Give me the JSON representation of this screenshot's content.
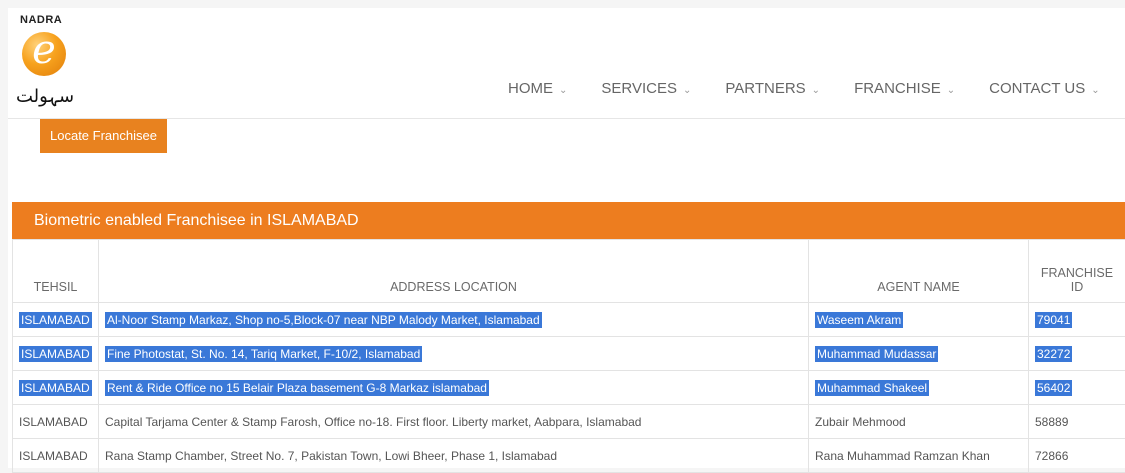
{
  "brand": {
    "top_label": "NADRA",
    "logo_letter": "e",
    "urdu_text": "سہولت"
  },
  "nav": {
    "items": [
      {
        "label": "HOME",
        "chev": "⌄"
      },
      {
        "label": "SERVICES",
        "chev": "⌄"
      },
      {
        "label": "PARTNERS",
        "chev": "⌄"
      },
      {
        "label": "FRANCHISE",
        "chev": "⌄"
      },
      {
        "label": "CONTACT US",
        "chev": "⌄"
      }
    ]
  },
  "locate_button": "Locate Franchisee",
  "panel": {
    "title": "Biometric enabled Franchisee in ISLAMABAD"
  },
  "table": {
    "headers": [
      "TEHSIL",
      "ADDRESS LOCATION",
      "AGENT NAME",
      "FRANCHISE ID"
    ],
    "rows": [
      {
        "tehsil": "ISLAMABAD",
        "address": "Al-Noor Stamp Markaz, Shop no-5,Block-07 near NBP Malody Market, Islamabad",
        "agent": "Waseem Akram",
        "id": "79041",
        "selected": true
      },
      {
        "tehsil": "ISLAMABAD",
        "address": "Fine Photostat, St. No. 14, Tariq Market, F-10/2, Islamabad",
        "agent": "Muhammad Mudassar",
        "id": "32272",
        "selected": true
      },
      {
        "tehsil": "ISLAMABAD",
        "address": "Rent & Ride Office no 15 Belair Plaza basement G-8 Markaz islamabad",
        "agent": "Muhammad Shakeel",
        "id": "56402",
        "selected": true
      },
      {
        "tehsil": "ISLAMABAD",
        "address": "Capital Tarjama Center & Stamp Farosh, Office no-18. First floor. Liberty market, Aabpara, Islamabad",
        "agent": "Zubair Mehmood",
        "id": "58889",
        "selected": false
      },
      {
        "tehsil": "ISLAMABAD",
        "address": "Rana Stamp Chamber, Street No. 7, Pakistan Town, Lowi Bheer, Phase 1, Islamabad",
        "agent": "Rana Muhammad Ramzan Khan",
        "id": "72866",
        "selected": false
      }
    ]
  },
  "colors": {
    "accent": "#ed7d1f",
    "selection": "#3a78d8"
  }
}
